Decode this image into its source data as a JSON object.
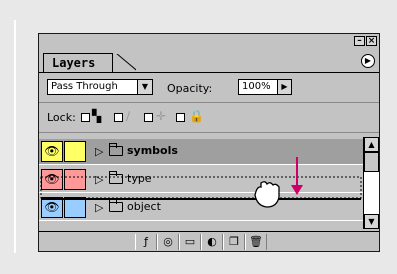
{
  "panel": {
    "tab_label": "Layers",
    "minimize_glyph": "–",
    "close_glyph": "×",
    "flyout_glyph": "▶"
  },
  "options": {
    "blend_mode": "Pass Through",
    "opacity_label": "Opacity:",
    "opacity_value": "100%"
  },
  "lock": {
    "label": "Lock:"
  },
  "layers": [
    {
      "name": "symbols",
      "color": "#ffff66",
      "selected": true
    },
    {
      "name": "type",
      "color": "#ff9999",
      "selected": false
    },
    {
      "name": "object",
      "color": "#99ccff",
      "selected": false
    }
  ],
  "accent": "#cc0066",
  "icons": [
    "eye-icon",
    "folder-icon",
    "hand-cursor-icon",
    "trash-icon",
    "new-layer-icon",
    "mask-icon"
  ]
}
